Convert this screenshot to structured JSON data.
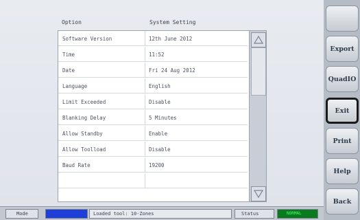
{
  "table": {
    "headers": {
      "option": "Option",
      "setting": "System Setting"
    },
    "rows": [
      {
        "option": "Software Version",
        "setting": "12th June 2012"
      },
      {
        "option": "Time",
        "setting": "11:52"
      },
      {
        "option": "Date",
        "setting": "Fri 24 Aug 2012"
      },
      {
        "option": "Language",
        "setting": "English"
      },
      {
        "option": "Limit Exceeded",
        "setting": "Disable"
      },
      {
        "option": "Blanking Delay",
        "setting": "5 Minutes"
      },
      {
        "option": "Allow Standby",
        "setting": "Enable"
      },
      {
        "option": "Allow Toolload",
        "setting": "Disable"
      },
      {
        "option": "Baud Rate",
        "setting": "19200"
      },
      {
        "option": "",
        "setting": ""
      }
    ]
  },
  "scrollbar": {
    "up_icon": "triangle-up",
    "down_icon": "triangle-down"
  },
  "side_buttons": [
    {
      "label": "",
      "state": "disabled"
    },
    {
      "label": "Export",
      "state": "normal"
    },
    {
      "label": "QuadIO",
      "state": "normal"
    },
    {
      "label": "Exit",
      "state": "selected"
    },
    {
      "label": "Print",
      "state": "normal"
    },
    {
      "label": "Help",
      "state": "normal"
    },
    {
      "label": "Back",
      "state": "normal"
    }
  ],
  "statusbar": {
    "mode_label": "Mode",
    "mode_color": "#1f3fd9",
    "message": "Loaded tool: 10-Zones",
    "status_label": "Status",
    "status_value": "NORMAL",
    "status_color": "#0a7a1f"
  }
}
